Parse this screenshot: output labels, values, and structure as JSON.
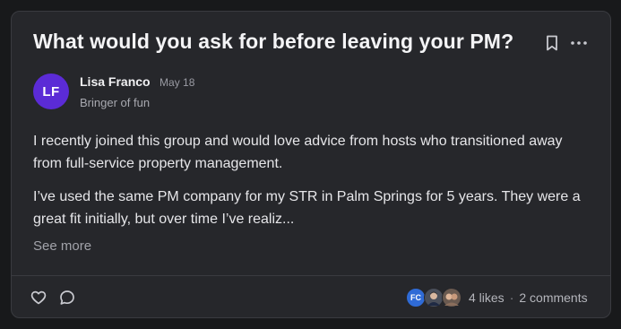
{
  "post": {
    "title": "What would you ask for before leaving your PM?",
    "author": {
      "initials": "LF",
      "name": "Lisa Franco",
      "date": "May 18",
      "role": "Bringer of fun",
      "avatar_color": "#5b2bd6"
    },
    "paragraphs": [
      "I recently joined this group and would love advice from hosts who transitioned away from full-service property management.",
      "I’ve used the same PM company for my STR in Palm Springs for 5 years. They were a great fit initially, but over time I’ve realiz..."
    ],
    "see_more_label": "See more",
    "footer": {
      "reactor_avatars": [
        {
          "initials": "FC",
          "color": "#2f6bd6"
        },
        {
          "icon": "person-avatar",
          "color": "#4a4f5a"
        },
        {
          "icon": "person-avatar",
          "color": "#6a5a50"
        }
      ],
      "likes": "4 likes",
      "separator": "·",
      "comments": "2 comments"
    }
  },
  "icons": {
    "bookmark": "bookmark-icon",
    "more": "more-horizontal-icon",
    "like": "heart-icon",
    "comment": "comment-bubble-icon"
  },
  "colors": {
    "page_background": "#18191b",
    "card_background": "#26272b",
    "card_border": "#3a3b40",
    "title_text": "#f4f4f6",
    "muted_text": "#a8a9b0"
  }
}
